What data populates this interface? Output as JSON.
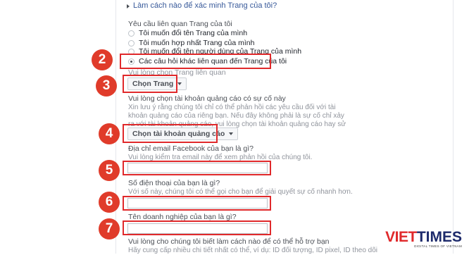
{
  "top_link": "Làm cách nào để xác minh Trang của tôi?",
  "request_section": {
    "label": "Yêu cầu liên quan Trang của tôi",
    "options": [
      {
        "label": "Tôi muốn đổi tên Trang của mình",
        "checked": false
      },
      {
        "label": "Tôi muốn hợp nhất Trang của mình",
        "checked": false
      },
      {
        "label": "Tôi muốn đổi tên người dùng của Trang của mình",
        "checked": false
      },
      {
        "label": "Các câu hỏi khác liên quan đến Trang của tôi",
        "checked": true
      }
    ]
  },
  "page_select": {
    "label": "Vui lòng chọn Trang liên quan",
    "button_label": "Chọn Trang"
  },
  "ad_account": {
    "label": "Vui lòng chọn tài khoản quảng cáo có sự cố này",
    "help": "Xin lưu ý rằng chúng tôi chỉ có thể phản hồi các yêu cầu đối với tài khoản quảng cáo của riêng bạn. Nếu đây không phải là sự cố chỉ xảy ra với tài khoản quảng cáo, vui lòng chọn tài khoản quảng cáo hay sử dụng nhất.",
    "button_label": "Chọn tài khoản quảng cáo"
  },
  "email": {
    "label": "Địa chỉ email Facebook của bạn là gì?",
    "help": "Vui lòng kiểm tra email này để xem phản hồi của chúng tôi.",
    "value": ""
  },
  "phone": {
    "label": "Số điện thoại của bạn là gì?",
    "help": "Với số này, chúng tôi có thể gọi cho bạn để giải quyết sự cố nhanh hơn.",
    "value": ""
  },
  "business": {
    "label": "Tên doanh nghiệp của bạn là gì?",
    "value": ""
  },
  "support": {
    "label": "Vui lòng cho chúng tôi biết làm cách nào để có thể hỗ trợ bạn",
    "help": "Hãy cung cấp nhiều chi tiết nhất có thể, ví dụ: ID đối tượng, ID pixel, ID theo dõi"
  },
  "annotations": [
    "2",
    "3",
    "4",
    "5",
    "6",
    "7"
  ],
  "logo": {
    "viet": "VIET",
    "times": "TIMES",
    "tagline": "DIGITAL TIMES OF VIETNAM"
  },
  "colors": {
    "link": "#365899",
    "annotation_red": "#e0292b",
    "muted_text": "#90949c"
  }
}
